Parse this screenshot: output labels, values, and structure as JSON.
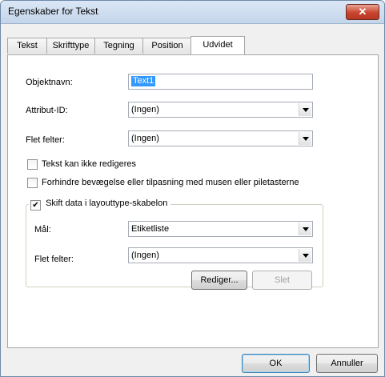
{
  "window": {
    "title": "Egenskaber for Tekst",
    "close_glyph": "✕"
  },
  "tabs": [
    {
      "label": "Tekst"
    },
    {
      "label": "Skrifttype"
    },
    {
      "label": "Tegning"
    },
    {
      "label": "Position"
    },
    {
      "label": "Udvidet"
    }
  ],
  "active_tab": "Udvidet",
  "form": {
    "object_name_label": "Objektnavn:",
    "object_name_value": "Text1",
    "attribute_id_label": "Attribut-ID:",
    "attribute_id_value": "(Ingen)",
    "merge_fields_label": "Flet felter:",
    "merge_fields_value": "(Ingen)",
    "check_not_editable": {
      "label": "Tekst kan ikke redigeres",
      "checked": false
    },
    "check_prevent_move": {
      "label": "Forhindre bevægelse eller tilpasning med musen eller piletasterne",
      "checked": false
    }
  },
  "layout_group": {
    "checkbox": {
      "label": "Skift data i layouttype-skabelon",
      "checked": true,
      "mark": "✔"
    },
    "target_label": "Mål:",
    "target_value": "Etiketliste",
    "merge_fields_label": "Flet felter:",
    "merge_fields_value": "(Ingen)",
    "edit_button": "Rediger...",
    "delete_button": "Slet"
  },
  "footer": {
    "ok_button": "OK",
    "cancel_button": "Annuller"
  }
}
